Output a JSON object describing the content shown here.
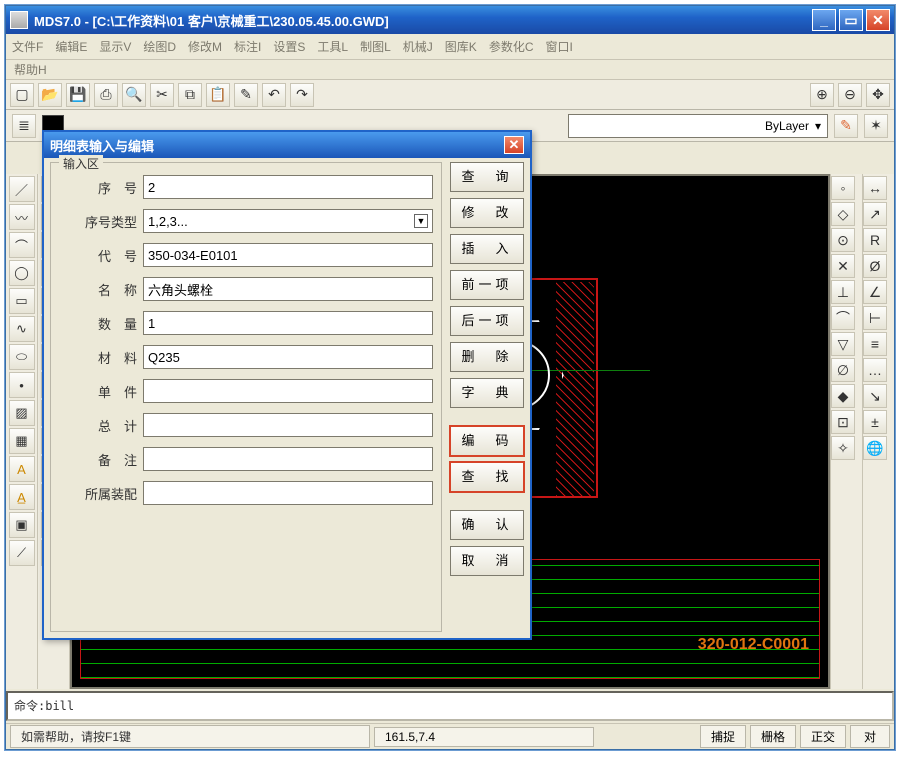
{
  "window": {
    "title": "MDS7.0 - [C:\\工作资料\\01 客户\\京械重工\\230.05.45.00.GWD]"
  },
  "menubar": {
    "items": [
      "文件F",
      "编辑E",
      "显示V",
      "绘图D",
      "修改M",
      "标注I",
      "设置S",
      "工具L",
      "制图L",
      "机械J",
      "图库K",
      "参数化C",
      "窗口I"
    ],
    "row2": "帮助H"
  },
  "layer": {
    "text": "ByLayer"
  },
  "canvas": {
    "code": "320-012-C0001"
  },
  "cmd": {
    "text": "命令:bill"
  },
  "status": {
    "help": "如需帮助，请按F1键",
    "coords": "161.5,7.4",
    "btns": [
      "捕捉",
      "栅格",
      "正交",
      "对"
    ]
  },
  "dialog": {
    "title": "明细表输入与编辑",
    "legend": "输入区",
    "fields": {
      "seq": {
        "label": "序　号",
        "value": "2"
      },
      "seqtype": {
        "label": "序号类型",
        "value": "1,2,3..."
      },
      "code": {
        "label": "代　号",
        "value": "350-034-E0101"
      },
      "name": {
        "label": "名　称",
        "value": "六角头螺栓"
      },
      "qty": {
        "label": "数　量",
        "value": "1"
      },
      "material": {
        "label": "材　料",
        "value": "Q235"
      },
      "single": {
        "label": "单　件",
        "value": ""
      },
      "total": {
        "label": "总　计",
        "value": ""
      },
      "note": {
        "label": "备　注",
        "value": ""
      },
      "assy": {
        "label": "所属装配",
        "value": ""
      }
    },
    "buttons": {
      "query": "查　询",
      "modify": "修　改",
      "insert": "插　入",
      "prev": "前一项",
      "next": "后一项",
      "delete": "删　除",
      "dict": "字　典",
      "encode": "编　码",
      "find": "查　找",
      "ok": "确　认",
      "cancel": "取　消"
    }
  }
}
